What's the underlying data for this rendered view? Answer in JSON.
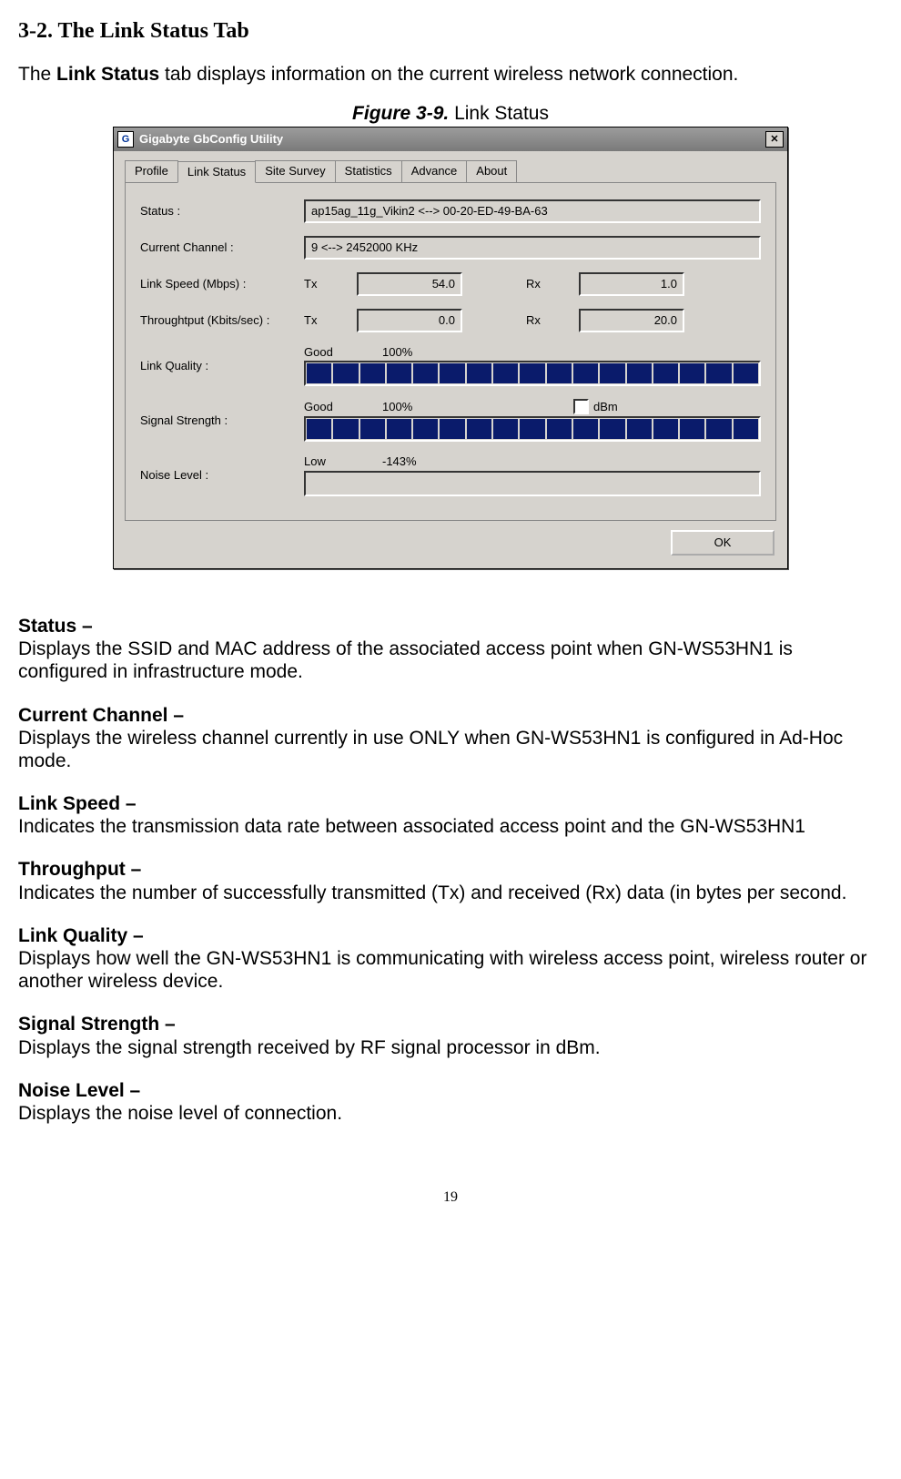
{
  "section_heading": "3-2.    The Link Status Tab",
  "intro_prefix": "The ",
  "intro_bold": "Link Status",
  "intro_suffix": " tab displays information on the current wireless network connection.",
  "figure_label_bold": "Figure 3-9.",
  "figure_label_rest": "    Link Status",
  "dialog": {
    "title": "Gigabyte GbConfig Utility",
    "icon_text": "G",
    "close_glyph": "✕",
    "tabs": {
      "profile": "Profile",
      "link_status": "Link Status",
      "site_survey": "Site Survey",
      "statistics": "Statistics",
      "advance": "Advance",
      "about": "About"
    },
    "labels": {
      "status": "Status :",
      "current_channel": "Current Channel :",
      "link_speed": "Link Speed (Mbps) :",
      "throughput": "Throughtput (Kbits/sec) :",
      "link_quality": "Link Quality :",
      "signal_strength": "Signal Strength :",
      "noise_level": "Noise Level :",
      "tx": "Tx",
      "rx": "Rx",
      "good": "Good",
      "low": "Low",
      "dbm": "dBm"
    },
    "values": {
      "status": "ap15ag_11g_Vikin2 <--> 00-20-ED-49-BA-63",
      "current_channel": "9 <--> 2452000 KHz",
      "link_speed_tx": "54.0",
      "link_speed_rx": "1.0",
      "throughput_tx": "0.0",
      "throughput_rx": "20.0",
      "link_quality_pct": "100%",
      "signal_strength_pct": "100%",
      "noise_level_pct": "-143%"
    },
    "ok_button": "OK"
  },
  "descriptions": {
    "status_term": "Status –",
    "status_body": "Displays the SSID and MAC address of the associated access point when GN-WS53HN1 is configured in infrastructure mode.",
    "channel_term": "Current Channel –",
    "channel_body": "Displays the wireless channel currently in use ONLY when GN-WS53HN1 is configured in Ad-Hoc mode.",
    "linkspeed_term": "Link Speed –",
    "linkspeed_body": "Indicates the transmission data rate between associated access point and the GN-WS53HN1",
    "throughput_term": "Throughput –",
    "throughput_body": "Indicates the number of successfully transmitted (Tx) and received (Rx) data (in bytes per second.",
    "linkquality_term": "Link Quality –",
    "linkquality_body": "Displays how well the GN-WS53HN1 is communicating with wireless access point, wireless router or another wireless device.",
    "signal_term": "Signal Strength –",
    "signal_body": "Displays the signal strength received by RF signal processor in dBm.",
    "noise_term": "Noise Level –",
    "noise_body": "Displays the noise level of connection."
  },
  "page_number": "19"
}
